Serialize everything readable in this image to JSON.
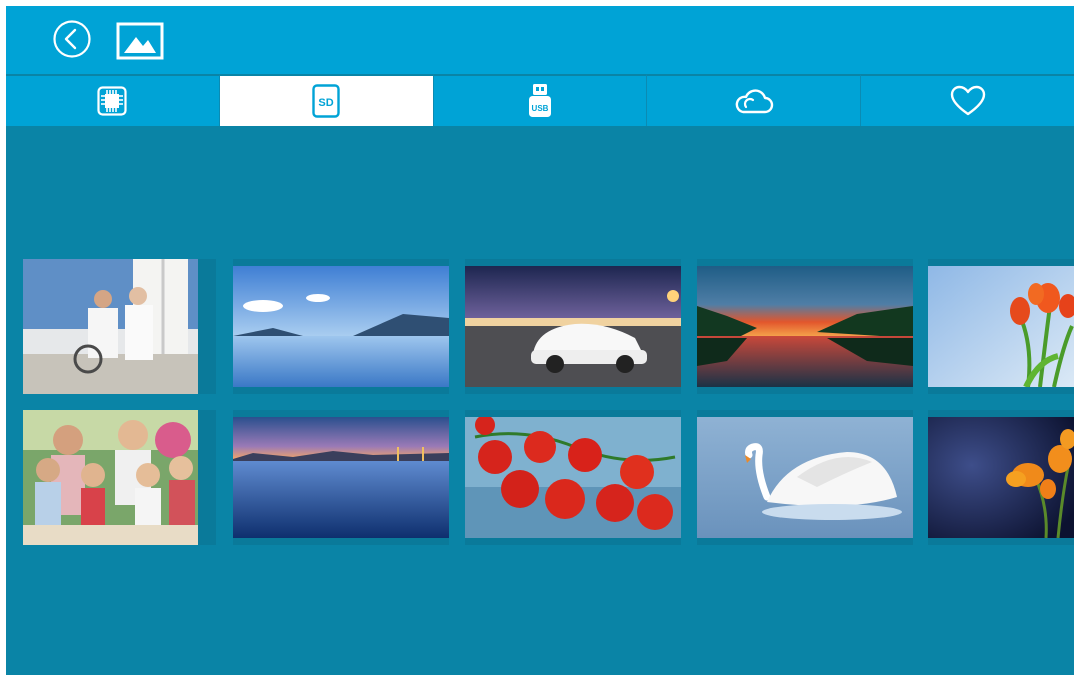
{
  "app": {
    "header": {
      "back_icon": "back-circle-icon",
      "gallery_icon": "image-gallery-icon"
    },
    "tabs": [
      {
        "id": "internal",
        "icon": "internal-memory-chip-icon",
        "active": false
      },
      {
        "id": "sd",
        "icon": "sd-card-icon",
        "label": "SD",
        "active": true
      },
      {
        "id": "usb",
        "icon": "usb-drive-icon",
        "label": "USB",
        "active": false
      },
      {
        "id": "cloud",
        "icon": "cloud-icon",
        "active": false
      },
      {
        "id": "favorites",
        "icon": "heart-icon",
        "active": false
      }
    ],
    "colors": {
      "topbar": "#00a3d6",
      "background": "#0a84a6",
      "active_tab": "#ffffff"
    },
    "photos": [
      {
        "row": 1,
        "col": 1,
        "subject": "couple-on-sailboat"
      },
      {
        "row": 1,
        "col": 2,
        "subject": "lake-mountain-reflection"
      },
      {
        "row": 1,
        "col": 3,
        "subject": "white-sports-car"
      },
      {
        "row": 1,
        "col": 4,
        "subject": "sunset-lake"
      },
      {
        "row": 1,
        "col": 5,
        "subject": "red-tulips"
      },
      {
        "row": 2,
        "col": 1,
        "subject": "family-laughing"
      },
      {
        "row": 2,
        "col": 2,
        "subject": "bay-bridge-dusk"
      },
      {
        "row": 2,
        "col": 3,
        "subject": "cherry-tomatoes"
      },
      {
        "row": 2,
        "col": 4,
        "subject": "white-swan"
      },
      {
        "row": 2,
        "col": 5,
        "subject": "orange-flowers"
      }
    ]
  }
}
